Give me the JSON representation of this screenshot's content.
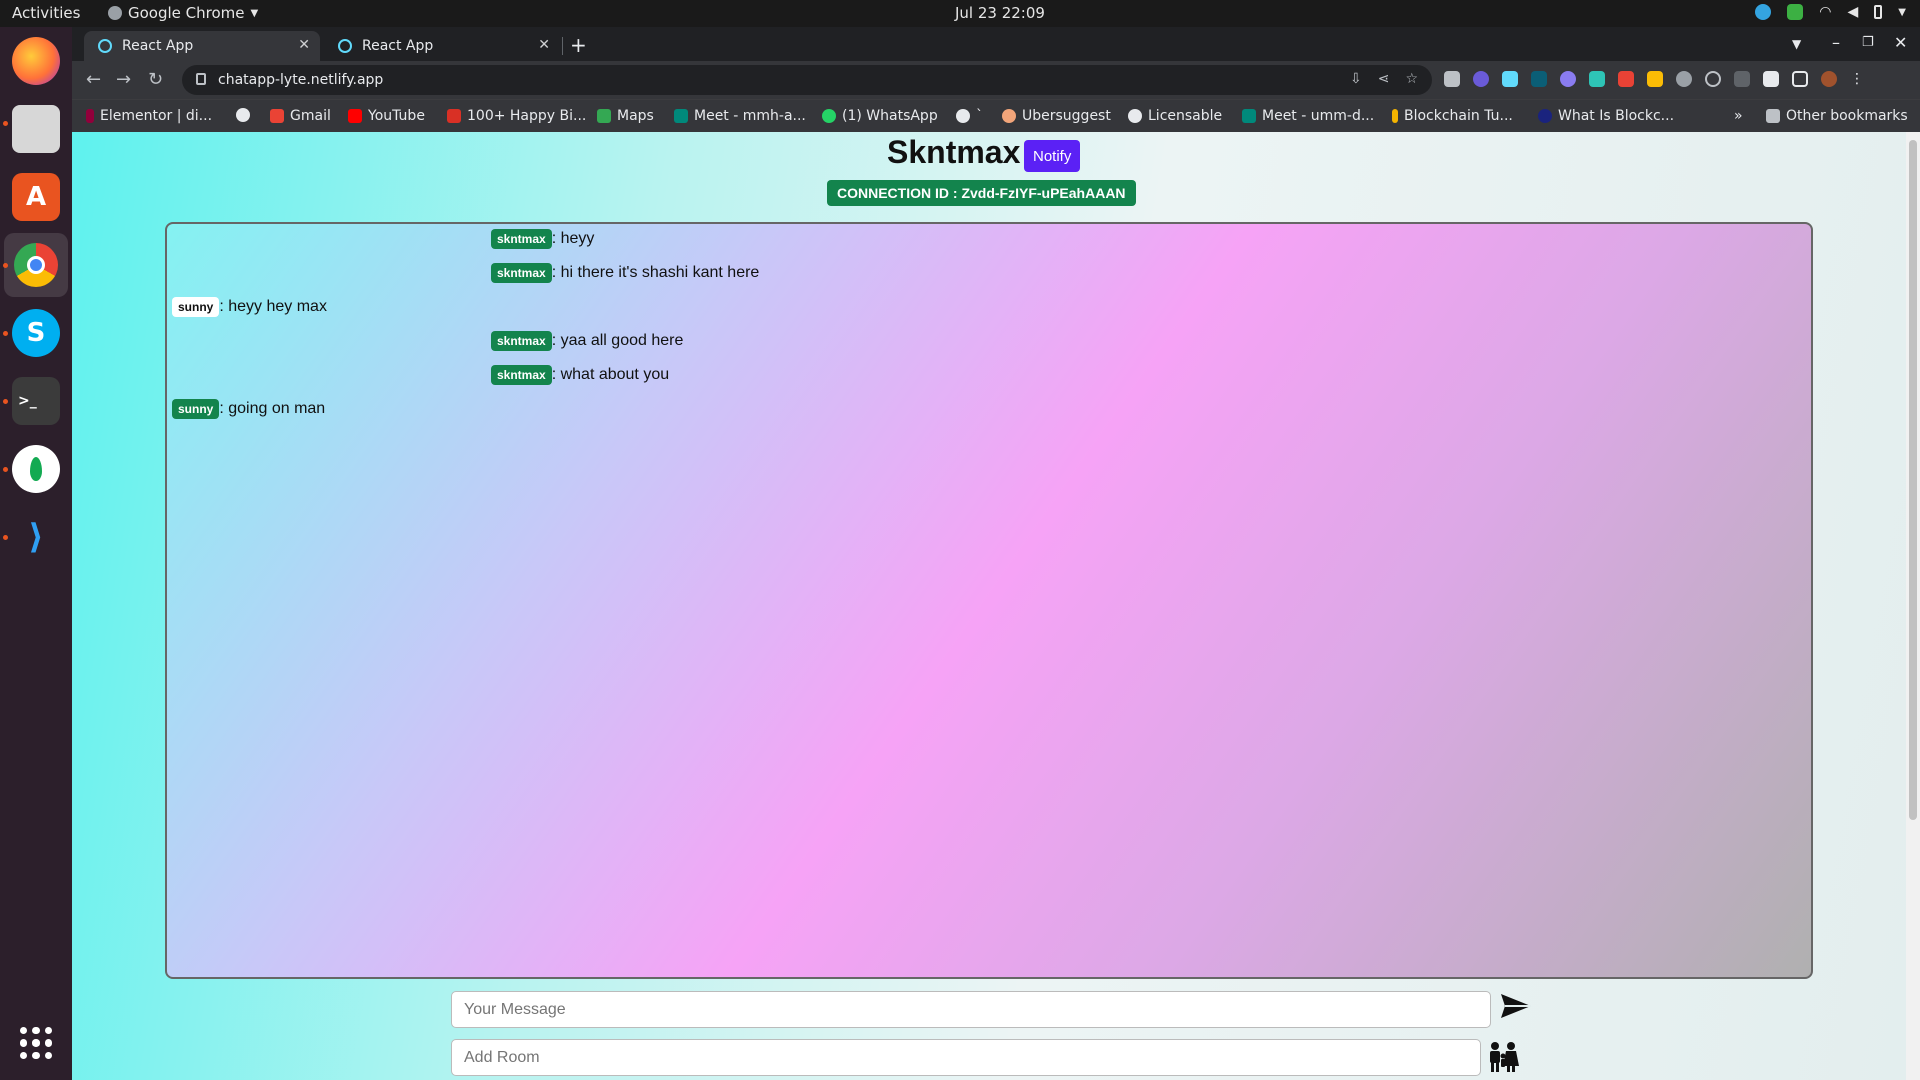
{
  "system": {
    "activities": "Activities",
    "app_name": "Google Chrome",
    "clock": "Jul 23  22:09"
  },
  "browser": {
    "tabs": [
      {
        "label": "React App"
      },
      {
        "label": "React App"
      }
    ],
    "url": "chatapp-lyte.netlify.app",
    "bookmarks": [
      "Elementor | di...",
      "Gmail",
      "YouTube",
      "100+ Happy Bi...",
      "Maps",
      "Meet - mmh-a...",
      "(1) WhatsApp",
      "`",
      "Ubersuggest",
      "Licensable",
      "Meet - umm-d...",
      "Blockchain Tu...",
      "What Is Blockc..."
    ],
    "more": "»",
    "other_bookmarks": "Other bookmarks"
  },
  "app": {
    "title": "Skntmax",
    "notify_label": "Notify",
    "connection_id": "CONNECTION ID : Zvdd-FzIYF-uPEahAAAN",
    "messages": [
      {
        "user": "skntmax",
        "text": ": heyy",
        "mine": true
      },
      {
        "user": "skntmax",
        "text": ": hi there it's shashi kant here",
        "mine": true
      },
      {
        "user": "sunny",
        "text": ": heyy hey max",
        "mine": false
      },
      {
        "user": "skntmax",
        "text": ": yaa all good here",
        "mine": true
      },
      {
        "user": "skntmax",
        "text": ": what about you",
        "mine": true
      },
      {
        "user": "sunny",
        "text": ": going on man",
        "mine": false
      }
    ],
    "message_placeholder": "Your Message",
    "room_placeholder": "Add Room"
  },
  "colors": {
    "notify": "#5b21f5",
    "badge_green": "#13844d"
  }
}
